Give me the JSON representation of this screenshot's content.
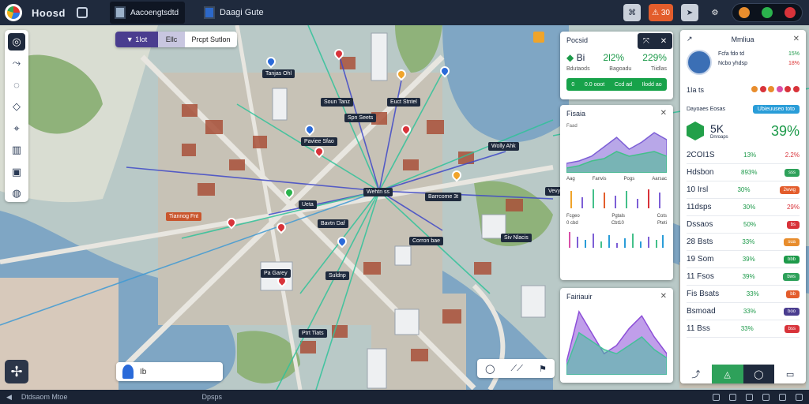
{
  "app": {
    "title": "Hoosd"
  },
  "tabs": [
    {
      "label": "Aacoengtsdtd"
    },
    {
      "label": "Daagi Gute"
    }
  ],
  "topbar_right": {
    "alert_label": "⚠ 30"
  },
  "map": {
    "toolbar": {
      "a": "▼ 1Iot",
      "b": "Ellc",
      "c": "Prcpt Sutlon"
    },
    "labels": [
      {
        "text": "Tanjas Ohl",
        "tone": "dark"
      },
      {
        "text": "Soun Tanz",
        "tone": "dark"
      },
      {
        "text": "Euct Stntel",
        "tone": "dark"
      },
      {
        "text": "Spn Seets",
        "tone": "dark"
      },
      {
        "text": "Paviee Sfao",
        "tone": "dark"
      },
      {
        "text": "Wolly Ahk",
        "tone": "dark"
      },
      {
        "text": "Wehtn ss",
        "tone": "dark"
      },
      {
        "text": "Barrcome 3t",
        "tone": "dark"
      },
      {
        "text": "Bavtn Daf",
        "tone": "dark"
      },
      {
        "text": "Ueta",
        "tone": "dark"
      },
      {
        "text": "Corron bae",
        "tone": "dark"
      },
      {
        "text": "Siv Nlacis",
        "tone": "dark"
      },
      {
        "text": "Pa Garey",
        "tone": "dark"
      },
      {
        "text": "Suldnp",
        "tone": "dark"
      },
      {
        "text": "Ptrt Tiats",
        "tone": "dark"
      },
      {
        "text": "Tiannog Fnt",
        "tone": "orange"
      },
      {
        "text": "Vevy Duin",
        "tone": "dark"
      }
    ],
    "search_text": "Ib",
    "controls": [
      "◯",
      "⟋⟋",
      "⚑"
    ]
  },
  "analytics_panel": {
    "title": "Pocsid",
    "kpis": [
      {
        "label": "Bi",
        "value": "2l2%"
      },
      {
        "label": "",
        "value": "229%"
      }
    ],
    "kpi_sub": [
      "Bdutaods",
      "Bagoadu",
      "Tiidlas"
    ],
    "bar_items": [
      "0",
      "0.0 ooot",
      "Ccd ad",
      "Ilodd ao"
    ]
  },
  "trends_panel": {
    "title": "Fisaia",
    "subtitle": "Faad",
    "row1": [
      "Aag",
      "Fanvis",
      "Pogs",
      "Aarsac"
    ],
    "row2": [
      "Fcgeo",
      "Pgtals",
      "Cots"
    ],
    "row3": [
      "0 cbd",
      "Cbt10",
      "Pteti"
    ],
    "chart_a": {
      "series": [
        {
          "color": "#7d5fd6",
          "values": [
            8,
            10,
            14,
            22,
            30,
            20,
            26,
            34,
            28
          ]
        },
        {
          "color": "#43c08a",
          "values": [
            4,
            6,
            10,
            12,
            18,
            14,
            16,
            18,
            14
          ]
        }
      ]
    }
  },
  "trends_panel2": {
    "title": "Fairiauir",
    "chart_b": {
      "series": [
        {
          "color": "#8d4fd8",
          "values": [
            6,
            30,
            20,
            10,
            14,
            22,
            28,
            18,
            10
          ]
        },
        {
          "color": "#45c09a",
          "values": [
            4,
            20,
            16,
            12,
            10,
            14,
            18,
            12,
            8
          ]
        }
      ]
    }
  },
  "right_panel": {
    "title": "Mmliua",
    "user_stats": [
      [
        "Fcfa fdo td",
        "15%"
      ],
      [
        "Ncbo yhdsp",
        "18%"
      ]
    ],
    "icons_text": "1Ia ts",
    "section_label": "Dayoaes Eosas",
    "section_button": "Ubieuuseo toto",
    "big_value": "5K",
    "big_sub": "Dnroaps",
    "big_pct": "39%",
    "rows": [
      {
        "label": "2COI1S",
        "a": "13%",
        "b": "2.2%",
        "badge": ""
      },
      {
        "label": "Hdsbon",
        "a": "893%",
        "b": "",
        "badge": "sss"
      },
      {
        "label": "10 Irsl",
        "a": "30%",
        "b": "",
        "badge": "2wwg"
      },
      {
        "label": "11dsps",
        "a": "30%",
        "b": "29%",
        "badge": ""
      },
      {
        "label": "Dssaos",
        "a": "50%",
        "b": "",
        "badge": "bs"
      },
      {
        "label": "28 Bsts",
        "a": "33%",
        "b": "",
        "badge": "sua"
      },
      {
        "label": "19 Som",
        "a": "39%",
        "b": "",
        "badge": "bbb"
      },
      {
        "label": "11 Fsos",
        "a": "39%",
        "b": "",
        "badge": "bws"
      },
      {
        "label": "Fis Bsats",
        "a": "33%",
        "b": "",
        "badge": "bb"
      },
      {
        "label": "Bsmoad",
        "a": "33%",
        "b": "",
        "badge": "boo"
      },
      {
        "label": "11 Bss",
        "a": "33%",
        "b": "",
        "badge": "bss"
      }
    ]
  },
  "statusbar": {
    "text": "Dtdsaom Mtoe",
    "middle": "Dpsps"
  },
  "colors": {
    "accent": "#1f2a3d",
    "green": "#1d9a4a",
    "orange": "#e35d2c",
    "purple": "#4a3d8f"
  }
}
